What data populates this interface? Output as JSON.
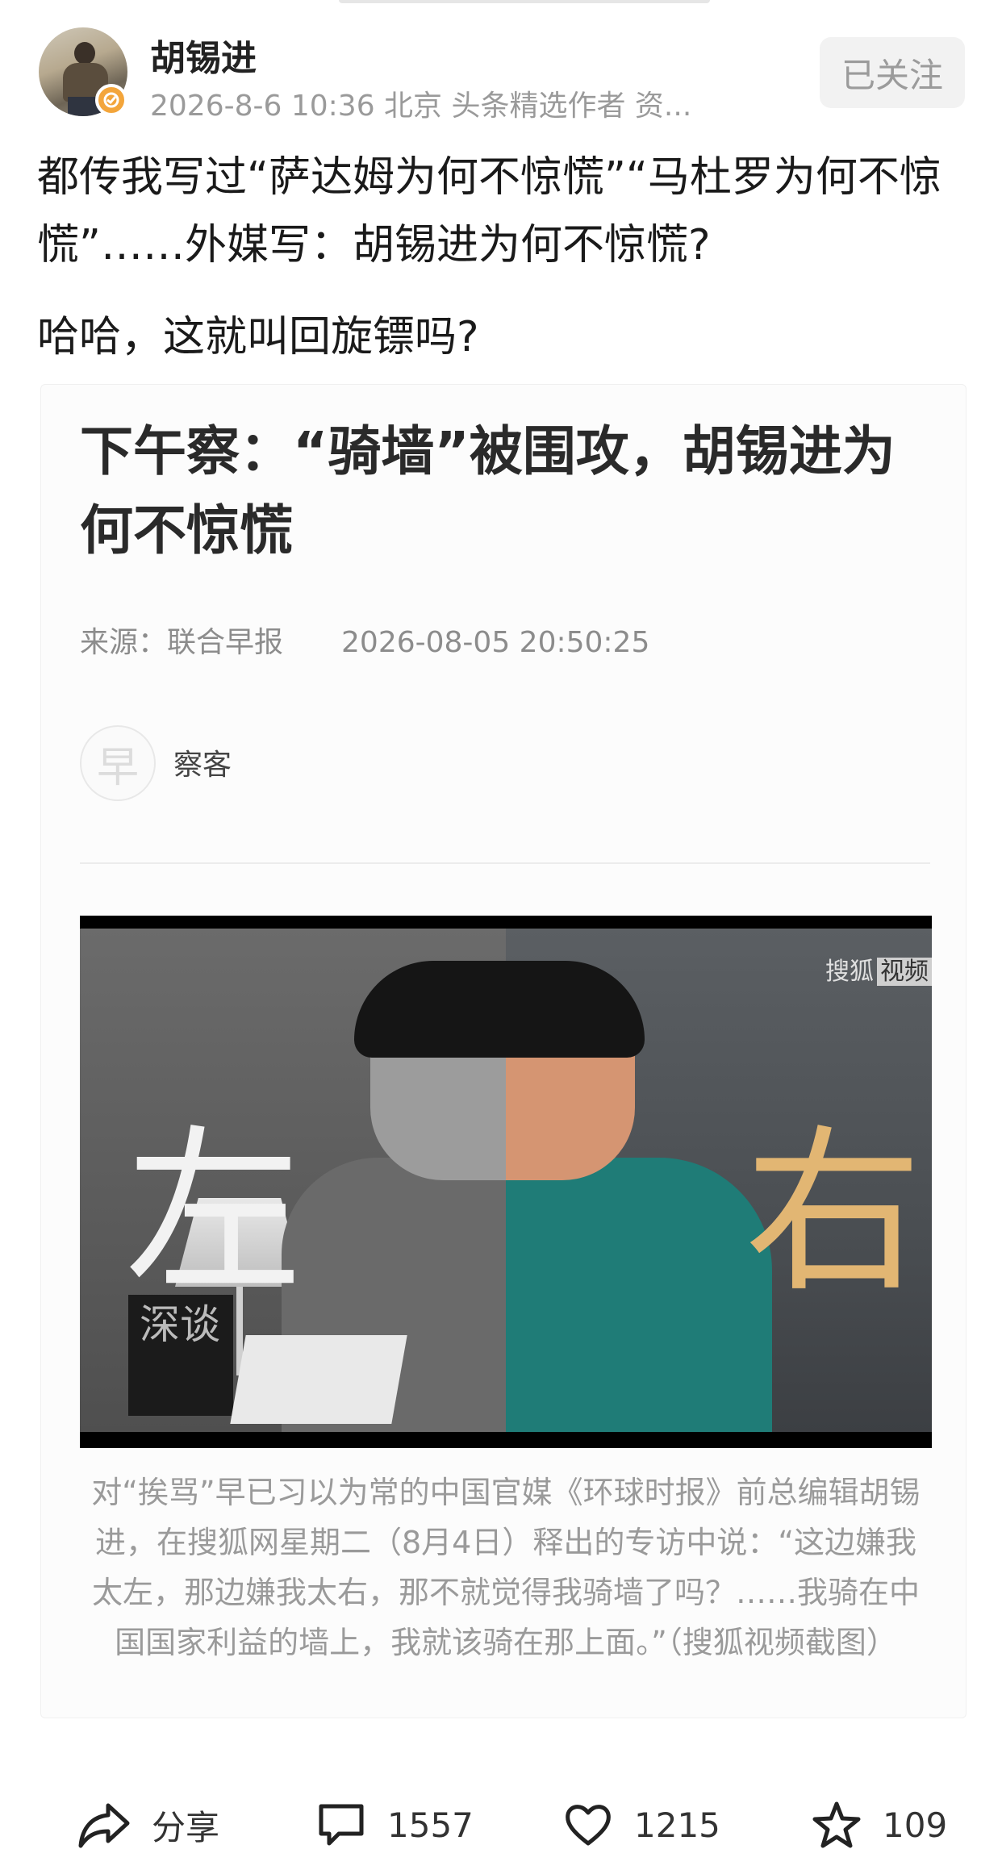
{
  "header": {
    "author_name": "胡锡进",
    "meta": "2026-8-6 10:36  北京  头条精选作者 资...",
    "follow_label": "已关注"
  },
  "post": {
    "text_line1": "都传我写过“萨达姆为何不惊慌”“马杜罗为何不惊慌”……外媒写：胡锡进为何不惊慌?",
    "text_line2": "哈哈，这就叫回旋镖吗?"
  },
  "article": {
    "title": "下午察：“骑墙”被围攻，胡锡进为何不惊慌",
    "source": "来源：联合早报",
    "date": "2026-08-05 20:50:25",
    "seal_char": "早",
    "byline": "察客",
    "image": {
      "left_char": "左",
      "right_char": "右",
      "book_text": "深谈",
      "watermark": "搜狐",
      "watermark_boxed": "视频"
    },
    "caption": "对“挨骂”早已习以为常的中国官媒《环球时报》前总编辑胡锡进，在搜狐网星期二（8月4日）释出的专访中说：“这边嫌我太左，那边嫌我太右，那不就觉得我骑墙了吗？……我骑在中国国家利益的墙上，我就该骑在那上面。”（搜狐视频截图）"
  },
  "actions": {
    "share_label": "分享",
    "comments": "1557",
    "likes": "1215",
    "favorites": "109"
  },
  "colors": {
    "accent_verify": "#f3a53b",
    "text_secondary": "#9a9a9a",
    "follow_bg": "#f2f2f2"
  }
}
